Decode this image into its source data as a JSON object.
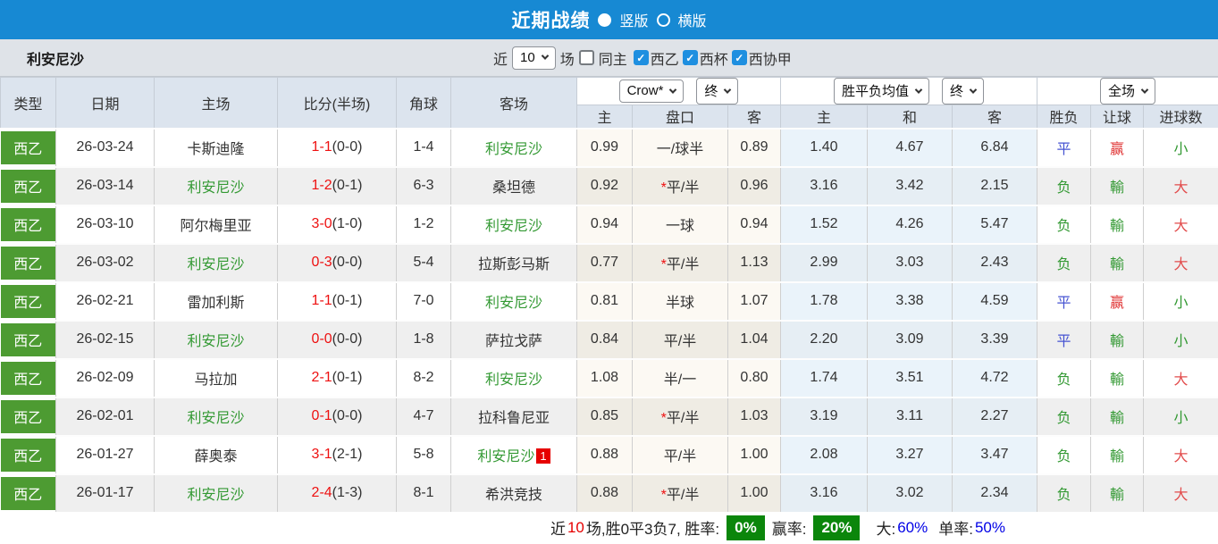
{
  "titlebar": {
    "title": "近期战绩",
    "radio_vertical_label": "竖版",
    "radio_horizontal_label": "横版"
  },
  "toolbar": {
    "team": "利安尼沙",
    "recent_label": "近",
    "recent_value": "10",
    "games_label": "场",
    "same_home_label": "同主",
    "filters": [
      {
        "label": "西乙",
        "checked": true
      },
      {
        "label": "西杯",
        "checked": true
      },
      {
        "label": "西协甲",
        "checked": true
      }
    ]
  },
  "table": {
    "columns": {
      "type": "类型",
      "date": "日期",
      "home": "主场",
      "score": "比分(半场)",
      "corners": "角球",
      "away": "客场",
      "odds_home": "主",
      "handicap": "盘口",
      "odds_away": "客",
      "avg_home": "主",
      "avg_draw": "和",
      "avg_away": "客",
      "result": "胜负",
      "handicap_result": "让球",
      "goals": "进球数"
    },
    "selects": {
      "company": "Crow*",
      "company_time": "终",
      "avg": "胜平负均值",
      "avg_time": "终",
      "scope": "全场"
    },
    "rows": [
      {
        "league": "西乙",
        "date": "26-03-24",
        "home": "卡斯迪隆",
        "score": "1-1",
        "half": "(0-0)",
        "corners": "1-4",
        "away": "利安尼沙",
        "away_badge": "",
        "odds_home": "0.99",
        "handicap": "一/球半",
        "odds_away": "0.89",
        "avg_home": "1.40",
        "avg_draw": "4.67",
        "avg_away": "6.84",
        "result": "平",
        "handicap_result": "赢",
        "goals": "小"
      },
      {
        "league": "西乙",
        "date": "26-03-14",
        "home": "利安尼沙",
        "score": "1-2",
        "half": "(0-1)",
        "corners": "6-3",
        "away": "桑坦德",
        "away_badge": "",
        "odds_home": "0.92",
        "handicap": "*平/半",
        "odds_away": "0.96",
        "avg_home": "3.16",
        "avg_draw": "3.42",
        "avg_away": "2.15",
        "result": "负",
        "handicap_result": "輸",
        "goals": "大"
      },
      {
        "league": "西乙",
        "date": "26-03-10",
        "home": "阿尔梅里亚",
        "score": "3-0",
        "half": "(1-0)",
        "corners": "1-2",
        "away": "利安尼沙",
        "away_badge": "",
        "odds_home": "0.94",
        "handicap": "一球",
        "odds_away": "0.94",
        "avg_home": "1.52",
        "avg_draw": "4.26",
        "avg_away": "5.47",
        "result": "负",
        "handicap_result": "輸",
        "goals": "大"
      },
      {
        "league": "西乙",
        "date": "26-03-02",
        "home": "利安尼沙",
        "score": "0-3",
        "half": "(0-0)",
        "corners": "5-4",
        "away": "拉斯彭马斯",
        "away_badge": "",
        "odds_home": "0.77",
        "handicap": "*平/半",
        "odds_away": "1.13",
        "avg_home": "2.99",
        "avg_draw": "3.03",
        "avg_away": "2.43",
        "result": "负",
        "handicap_result": "輸",
        "goals": "大"
      },
      {
        "league": "西乙",
        "date": "26-02-21",
        "home": "雷加利斯",
        "score": "1-1",
        "half": "(0-1)",
        "corners": "7-0",
        "away": "利安尼沙",
        "away_badge": "",
        "odds_home": "0.81",
        "handicap": "半球",
        "odds_away": "1.07",
        "avg_home": "1.78",
        "avg_draw": "3.38",
        "avg_away": "4.59",
        "result": "平",
        "handicap_result": "赢",
        "goals": "小"
      },
      {
        "league": "西乙",
        "date": "26-02-15",
        "home": "利安尼沙",
        "score": "0-0",
        "half": "(0-0)",
        "corners": "1-8",
        "away": "萨拉戈萨",
        "away_badge": "",
        "odds_home": "0.84",
        "handicap": "平/半",
        "odds_away": "1.04",
        "avg_home": "2.20",
        "avg_draw": "3.09",
        "avg_away": "3.39",
        "result": "平",
        "handicap_result": "輸",
        "goals": "小"
      },
      {
        "league": "西乙",
        "date": "26-02-09",
        "home": "马拉加",
        "score": "2-1",
        "half": "(0-1)",
        "corners": "8-2",
        "away": "利安尼沙",
        "away_badge": "",
        "odds_home": "1.08",
        "handicap": "半/一",
        "odds_away": "0.80",
        "avg_home": "1.74",
        "avg_draw": "3.51",
        "avg_away": "4.72",
        "result": "负",
        "handicap_result": "輸",
        "goals": "大"
      },
      {
        "league": "西乙",
        "date": "26-02-01",
        "home": "利安尼沙",
        "score": "0-1",
        "half": "(0-0)",
        "corners": "4-7",
        "away": "拉科鲁尼亚",
        "away_badge": "",
        "odds_home": "0.85",
        "handicap": "*平/半",
        "odds_away": "1.03",
        "avg_home": "3.19",
        "avg_draw": "3.11",
        "avg_away": "2.27",
        "result": "负",
        "handicap_result": "輸",
        "goals": "小"
      },
      {
        "league": "西乙",
        "date": "26-01-27",
        "home": "薛奥泰",
        "score": "3-1",
        "half": "(2-1)",
        "corners": "5-8",
        "away": "利安尼沙",
        "away_badge": "1",
        "odds_home": "0.88",
        "handicap": "平/半",
        "odds_away": "1.00",
        "avg_home": "2.08",
        "avg_draw": "3.27",
        "avg_away": "3.47",
        "result": "负",
        "handicap_result": "輸",
        "goals": "大"
      },
      {
        "league": "西乙",
        "date": "26-01-17",
        "home": "利安尼沙",
        "score": "2-4",
        "half": "(1-3)",
        "corners": "8-1",
        "away": "希洪竞技",
        "away_badge": "",
        "odds_home": "0.88",
        "handicap": "*平/半",
        "odds_away": "1.00",
        "avg_home": "3.16",
        "avg_draw": "3.02",
        "avg_away": "2.34",
        "result": "负",
        "handicap_result": "輸",
        "goals": "大"
      }
    ]
  },
  "footer": {
    "prefix": "近",
    "count": "10",
    "summary": "场,胜0平3负7, 胜率:",
    "win_rate": "0%",
    "odds_win_label": "赢率:",
    "odds_win_rate": "20%",
    "big_label": "大:",
    "big_rate": "60%",
    "single_label": "单率:",
    "single_rate": "50%"
  },
  "colors": {
    "topbar_blue": "#1789d3",
    "league_green": "#4d9b32",
    "team_green": "#339933",
    "score_red": "#ee1111",
    "draw_blue": "#4653d2",
    "footer_badge_green": "#0b860b",
    "footer_blue": "#0000e6"
  }
}
